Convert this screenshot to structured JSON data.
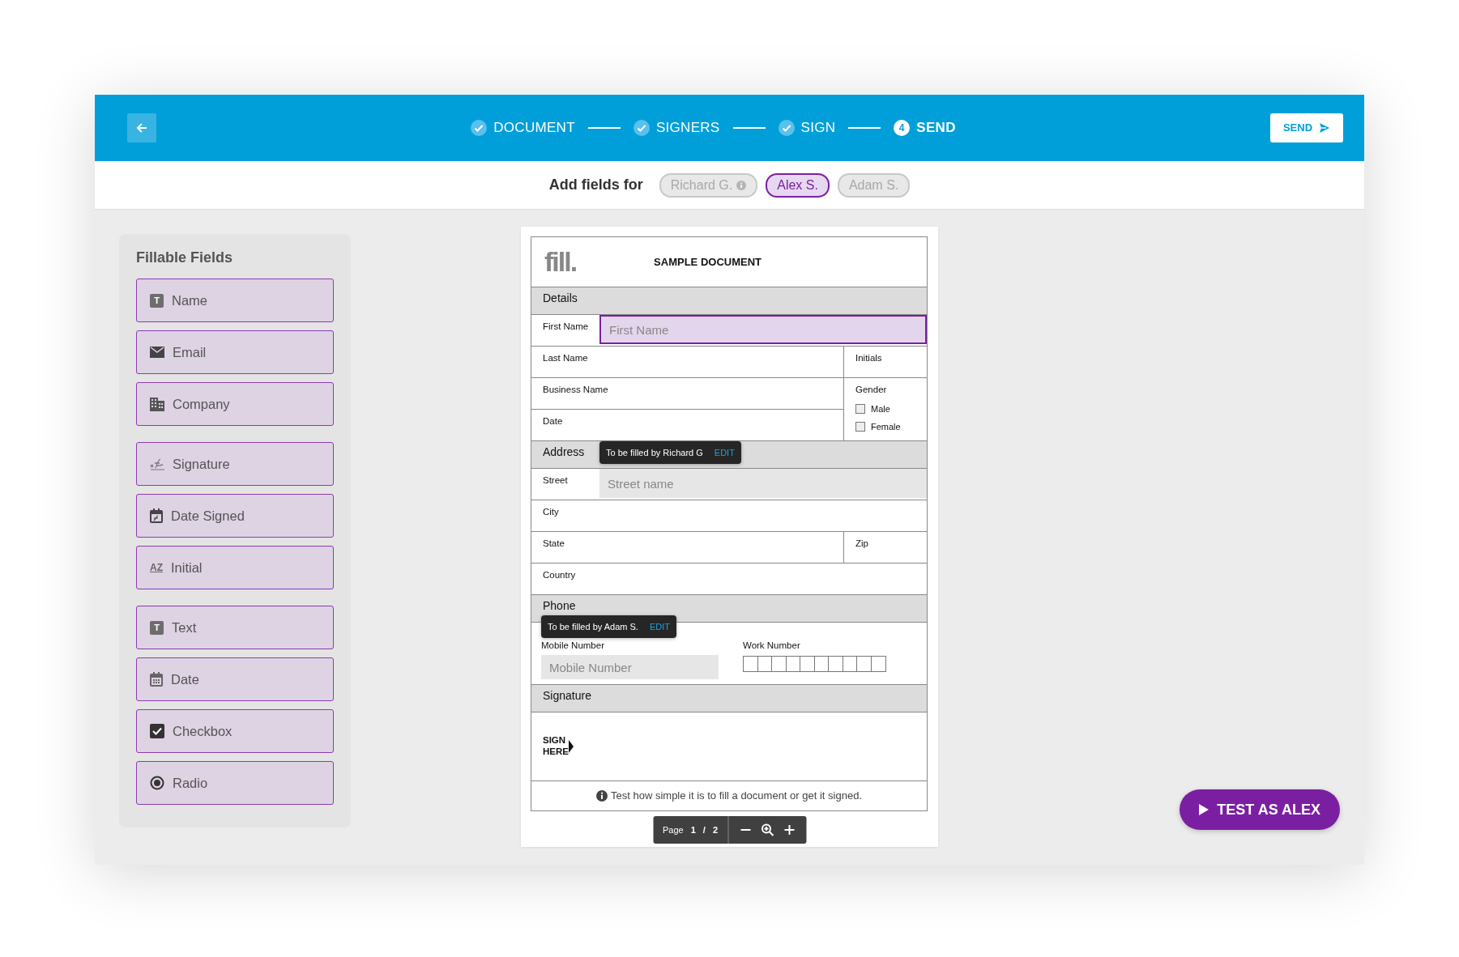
{
  "header": {
    "steps": [
      {
        "label": "DOCUMENT",
        "completed": true,
        "selected": false
      },
      {
        "label": "SIGNERS",
        "completed": true,
        "selected": false
      },
      {
        "label": "SIGN",
        "completed": true,
        "selected": false
      },
      {
        "label": "SEND",
        "completed": false,
        "selected": true,
        "number": "4"
      }
    ],
    "send_button": "SEND"
  },
  "signers": {
    "label": "Add fields for",
    "items": [
      {
        "name": "Richard G.",
        "selected": false,
        "info": true
      },
      {
        "name": "Alex S.",
        "selected": true,
        "info": false
      },
      {
        "name": "Adam S.",
        "selected": false,
        "info": false
      }
    ]
  },
  "sidebar": {
    "title": "Fillable Fields",
    "groups": [
      [
        {
          "label": "Name",
          "icon_text": "T"
        },
        {
          "label": "Email"
        },
        {
          "label": "Company"
        }
      ],
      [
        {
          "label": "Signature"
        },
        {
          "label": "Date Signed"
        },
        {
          "label": "Initial",
          "icon_text": "AZ"
        }
      ],
      [
        {
          "label": "Text",
          "icon_text": "T"
        },
        {
          "label": "Date"
        },
        {
          "label": "Checkbox"
        },
        {
          "label": "Radio"
        }
      ]
    ]
  },
  "document": {
    "logo": "fill.",
    "title": "SAMPLE DOCUMENT",
    "sections": [
      {
        "title": "Details",
        "rows": [
          [
            {
              "kind": "input",
              "label": "First Name",
              "placeholder": "First Name",
              "highlighted": true,
              "colspan": 2
            }
          ],
          [
            {
              "kind": "text",
              "label": "Last Name"
            },
            {
              "kind": "text",
              "label": "Initials"
            }
          ],
          [
            {
              "kind": "text",
              "label": "Business Name"
            },
            {
              "kind": "choice",
              "label": "Gender",
              "rowspan": 2,
              "options": [
                {
                  "label": "Male",
                  "checked": false
                },
                {
                  "label": "Female",
                  "checked": false
                }
              ]
            }
          ],
          [
            {
              "kind": "text",
              "label": "Date"
            }
          ]
        ]
      },
      {
        "title": "Address",
        "rows": [
          [
            {
              "kind": "input",
              "label": "Street",
              "placeholder": "Street name",
              "highlighted": false,
              "colspan": 2,
              "tip": {
                "text": "To be filled by Richard G",
                "action": "EDIT"
              }
            }
          ],
          [
            {
              "kind": "text",
              "label": "City",
              "colspan": 2
            }
          ],
          [
            {
              "kind": "text",
              "label": "State"
            },
            {
              "kind": "text",
              "label": "Zip"
            }
          ],
          [
            {
              "kind": "text",
              "label": "Country",
              "colspan": 2
            }
          ]
        ]
      },
      {
        "title": "Phone",
        "rows": [
          [
            {
              "kind": "stacked-input",
              "label": "Mobile Number",
              "placeholder": "Mobile Number",
              "highlighted": false,
              "tip": {
                "text": "To be filled by Adam S.",
                "action": "EDIT"
              }
            },
            {
              "kind": "boxes",
              "label": "Work Number"
            }
          ]
        ]
      },
      {
        "title": "Signature",
        "rows": [
          [
            {
              "kind": "sign",
              "label": "SIGN HERE",
              "colspan": 2
            }
          ]
        ]
      }
    ],
    "note": "Test how simple it is to fill a document or get it signed.",
    "pager": {
      "label": "Page",
      "current": "1",
      "separator": "/",
      "total": "2"
    }
  },
  "test_button": "TEST AS ALEX"
}
